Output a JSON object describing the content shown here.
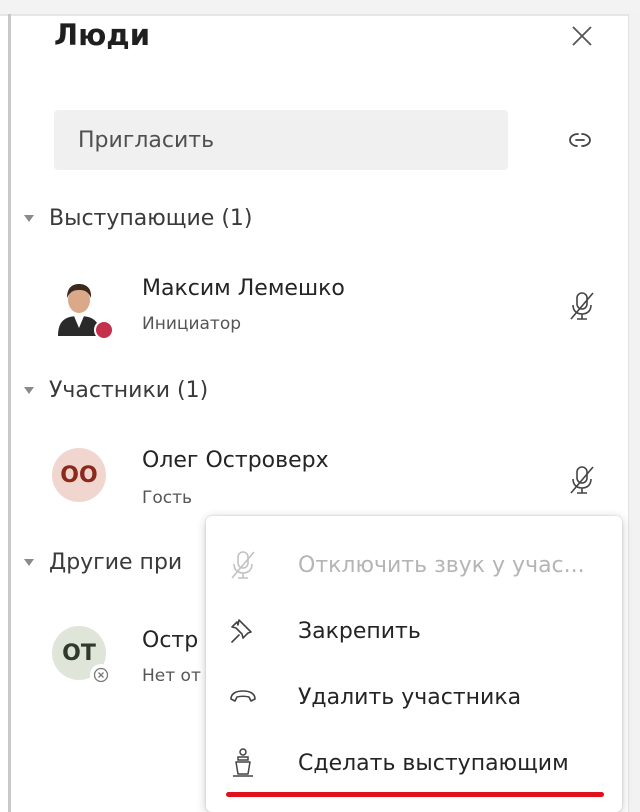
{
  "panel": {
    "title": "Люди",
    "invite_label": "Пригласить"
  },
  "sections": {
    "presenters_header": "Выступающие (1)",
    "attendees_header": "Участники (1)",
    "others_header_partial": "Другие при"
  },
  "people": [
    {
      "name": "Максим Лемешко",
      "role": "Инициатор",
      "avatar_type": "photo",
      "status_color": "#c4314b"
    },
    {
      "name": "Олег Островерх",
      "role": "Гость",
      "initials": "ОО",
      "avatar_bg": "#f1d6d0",
      "avatar_fg": "#8a2a1c"
    },
    {
      "name_partial": "Остр",
      "role_partial": "Нет от",
      "initials": "ОТ",
      "avatar_bg": "#dfe6d9",
      "avatar_fg": "#2f3a2b"
    }
  ],
  "context_menu": {
    "items": [
      {
        "label": "Отключить звук у учас...",
        "icon": "mic-off-icon",
        "disabled": true
      },
      {
        "label": "Закрепить",
        "icon": "pin-icon",
        "disabled": false
      },
      {
        "label": "Удалить участника",
        "icon": "hang-up-icon",
        "disabled": false
      },
      {
        "label": "Сделать выступающим",
        "icon": "podium-icon",
        "disabled": false
      }
    ]
  },
  "colors": {
    "highlight_underline": "#e0101d",
    "invite_bg": "#f0f0f0"
  }
}
